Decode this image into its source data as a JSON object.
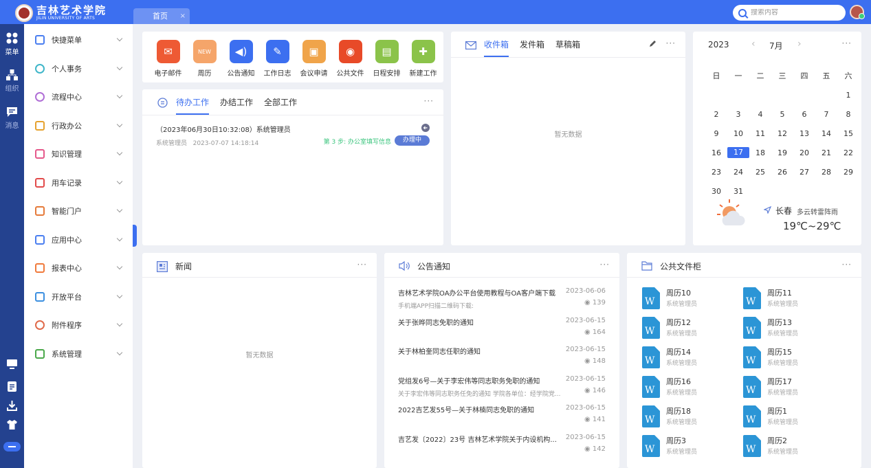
{
  "header": {
    "logo_cn": "吉林艺术学院",
    "logo_en": "JILIN UNIVERSITY OF ARTS",
    "tab_home": "首页",
    "tab_close": "×",
    "search_placeholder": "搜索内容"
  },
  "rail": [
    {
      "label": "菜单",
      "icon": "grid-icon"
    },
    {
      "label": "组织",
      "icon": "org-icon"
    },
    {
      "label": "消息",
      "icon": "message-icon"
    }
  ],
  "sidebar": {
    "items": [
      {
        "label": "快捷菜单",
        "icon": "apps-icon",
        "color": "#4a7ef0"
      },
      {
        "label": "个人事务",
        "icon": "user-icon",
        "color": "#3fb6c9"
      },
      {
        "label": "流程中心",
        "icon": "flow-icon",
        "color": "#b06fd6"
      },
      {
        "label": "行政办公",
        "icon": "briefcase-icon",
        "color": "#e6a22e"
      },
      {
        "label": "知识管理",
        "icon": "book-icon",
        "color": "#e5588a"
      },
      {
        "label": "用车记录",
        "icon": "truck-icon",
        "color": "#e24a4a"
      },
      {
        "label": "智能门户",
        "icon": "portal-icon",
        "color": "#e57a3a"
      },
      {
        "label": "应用中心",
        "icon": "app-center-icon",
        "color": "#4a7ef0"
      },
      {
        "label": "报表中心",
        "icon": "chart-icon",
        "color": "#f07a3c"
      },
      {
        "label": "开放平台",
        "icon": "cube-icon",
        "color": "#3c8fe0"
      },
      {
        "label": "附件程序",
        "icon": "paperclip-icon",
        "color": "#e06a4a"
      },
      {
        "label": "系统管理",
        "icon": "settings-icon",
        "color": "#4aa84a"
      }
    ]
  },
  "quick": [
    {
      "label": "电子邮件",
      "color": "#ee5a34",
      "glyph": "✉"
    },
    {
      "label": "周历",
      "color": "#f5a56a",
      "glyph": "NEW"
    },
    {
      "label": "公告通知",
      "color": "#3c6ff0",
      "glyph": "◀)"
    },
    {
      "label": "工作日志",
      "color": "#3c6ff0",
      "glyph": "✎"
    },
    {
      "label": "会议申请",
      "color": "#f0a44a",
      "glyph": "▣"
    },
    {
      "label": "公共文件",
      "color": "#e84a28",
      "glyph": "◉"
    },
    {
      "label": "日程安排",
      "color": "#8bc34a",
      "glyph": "▤"
    },
    {
      "label": "新建工作",
      "color": "#8bc34a",
      "glyph": "✚"
    }
  ],
  "tasks": {
    "tabs": [
      "待办工作",
      "办结工作",
      "全部工作"
    ],
    "more": "···",
    "item": {
      "title": "（2023年06月30日10:32:08）系统管理员",
      "user": "系统管理员",
      "time": "2023-07-07 14:18:14",
      "step": "第 3 步: 办公室填写信息",
      "status": "办理中"
    }
  },
  "mail": {
    "tabs": [
      "收件箱",
      "发件箱",
      "草稿箱"
    ],
    "more": "···",
    "empty": "暂无数据"
  },
  "calendar": {
    "year": "2023",
    "month": "7月",
    "prev": "‹",
    "next": "›",
    "more": "···",
    "weekdays": [
      "日",
      "一",
      "二",
      "三",
      "四",
      "五",
      "六"
    ],
    "weeks": [
      [
        "",
        "",
        "",
        "",
        "",
        "",
        "1"
      ],
      [
        "2",
        "3",
        "4",
        "5",
        "6",
        "7",
        "8"
      ],
      [
        "9",
        "10",
        "11",
        "12",
        "13",
        "14",
        "15"
      ],
      [
        "16",
        "17",
        "18",
        "19",
        "20",
        "21",
        "22"
      ],
      [
        "23",
        "24",
        "25",
        "26",
        "27",
        "28",
        "29"
      ],
      [
        "30",
        "31",
        "",
        "",
        "",
        "",
        ""
      ]
    ],
    "today": "17",
    "weather": {
      "city": "长春",
      "desc": "多云转雷阵雨",
      "temp": "19℃~29℃"
    }
  },
  "news": {
    "title": "新闻",
    "more": "···",
    "empty": "暂无数据"
  },
  "announcements": {
    "title": "公告通知",
    "more": "···",
    "items": [
      {
        "title": "吉林艺术学院OA办公平台使用教程与OA客户端下载",
        "date": "2023-06-06",
        "sub": "手机端APP扫描二维码下载:",
        "views": "139"
      },
      {
        "title": "关于张晔同志免职的通知",
        "date": "2023-06-15",
        "sub": "",
        "views": "164"
      },
      {
        "title": "关于林柏奎同志任职的通知",
        "date": "2023-06-15",
        "sub": "",
        "views": "148"
      },
      {
        "title": "党组发6号—关于李宏伟等同志职务免职的通知",
        "date": "2023-06-15",
        "sub": "关于李宏伟等同志职务任免的通知 学院各单位：经学院党...",
        "views": "146"
      },
      {
        "title": "2022吉艺发55号—关于林楠同志免职的通知",
        "date": "2023-06-15",
        "sub": "",
        "views": "141"
      },
      {
        "title": "吉艺发〔2022〕23号 吉林艺术学院关于内设机构...",
        "date": "2023-06-15",
        "sub": "",
        "views": "142"
      }
    ]
  },
  "files": {
    "title": "公共文件柜",
    "more": "···",
    "items": [
      {
        "name": "周历10",
        "owner": "系统管理员"
      },
      {
        "name": "周历11",
        "owner": "系统管理员"
      },
      {
        "name": "周历12",
        "owner": "系统管理员"
      },
      {
        "name": "周历13",
        "owner": "系统管理员"
      },
      {
        "name": "周历14",
        "owner": "系统管理员"
      },
      {
        "name": "周历15",
        "owner": "系统管理员"
      },
      {
        "name": "周历16",
        "owner": "系统管理员"
      },
      {
        "name": "周历17",
        "owner": "系统管理员"
      },
      {
        "name": "周历18",
        "owner": "系统管理员"
      },
      {
        "name": "周历1",
        "owner": "系统管理员"
      },
      {
        "name": "周历3",
        "owner": "系统管理员"
      },
      {
        "name": "周历2",
        "owner": "系统管理员"
      }
    ]
  }
}
